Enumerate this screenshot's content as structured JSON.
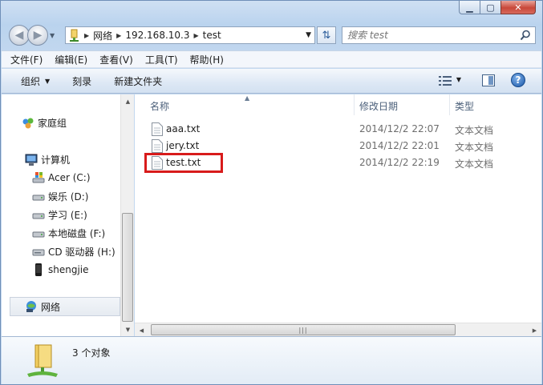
{
  "window": {
    "minimize_label": "▁",
    "maximize_label": "▢",
    "close_label": "✕"
  },
  "address": {
    "segments": [
      "网络",
      "192.168.10.3",
      "test"
    ]
  },
  "search": {
    "placeholder": "搜索 test"
  },
  "menu": [
    "文件(F)",
    "编辑(E)",
    "查看(V)",
    "工具(T)",
    "帮助(H)"
  ],
  "commands": {
    "organize": "组织",
    "burn": "刻录",
    "new_folder": "新建文件夹"
  },
  "help_label": "?",
  "navpane": {
    "homegroup": "家庭组",
    "computer": "计算机",
    "drives": [
      "Acer (C:)",
      "娱乐 (D:)",
      "学习 (E:)",
      "本地磁盘 (F:)",
      "CD 驱动器 (H:)",
      "shengjie"
    ],
    "network": "网络"
  },
  "columns": {
    "name": "名称",
    "date": "修改日期",
    "type": "类型"
  },
  "files": [
    {
      "name": "aaa.txt",
      "date": "2014/12/2 22:07",
      "type": "文本文档"
    },
    {
      "name": "jery.txt",
      "date": "2014/12/2 22:01",
      "type": "文本文档"
    },
    {
      "name": "test.txt",
      "date": "2014/12/2 22:19",
      "type": "文本文档"
    }
  ],
  "details": {
    "count": "3 个对象"
  },
  "colors": {
    "highlight": "#d81b1b",
    "accent": "#1b58a8"
  }
}
